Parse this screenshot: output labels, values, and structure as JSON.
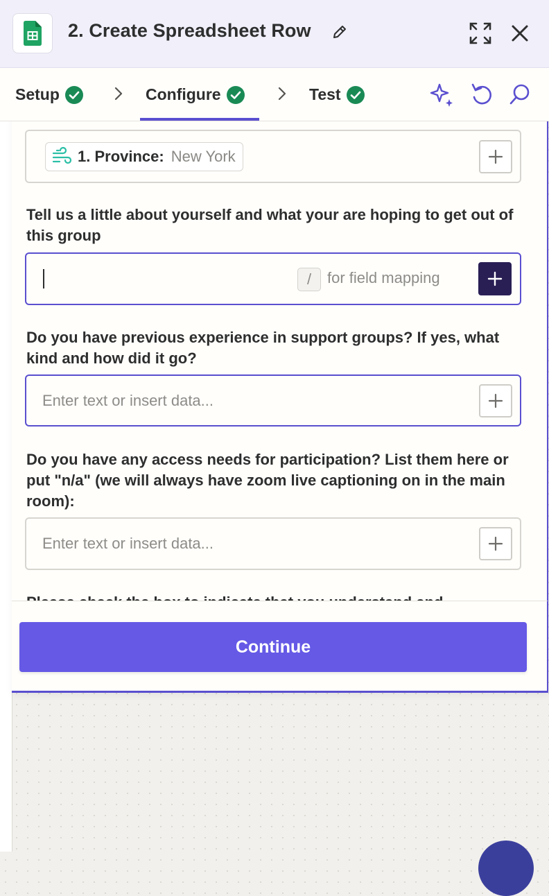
{
  "header": {
    "title": "2. Create Spreadsheet Row"
  },
  "tabs": [
    {
      "label": "Setup",
      "status": "complete"
    },
    {
      "label": "Configure",
      "status": "complete",
      "active": true
    },
    {
      "label": "Test",
      "status": "complete"
    }
  ],
  "fields": {
    "province_chip": {
      "key": "1. Province:",
      "value": "New York"
    },
    "about_yourself": {
      "label": "Tell us a little about yourself and what your are hoping to get out of this group",
      "slash_key": "/",
      "hint": "for field mapping",
      "value": ""
    },
    "experience": {
      "label": "Do you have previous experience in support groups? If yes, what kind and how did it go?",
      "placeholder": "Enter text or insert data..."
    },
    "access_needs": {
      "label": "Do you have any access needs for participation? List them here or put \"n/a\" (we will always have zoom live captioning on in the main room):",
      "placeholder": "Enter text or insert data..."
    },
    "checkbox_partial": {
      "label": "Please check the box to indicate that you understand and"
    }
  },
  "footer": {
    "continue_label": "Continue"
  },
  "colors": {
    "accent": "#5a4fcf",
    "button": "#6559e6",
    "success": "#1a8a55",
    "sheets_green": "#1fa463"
  },
  "icons": {
    "app": "google-sheets-icon",
    "edit": "pencil-icon",
    "expand": "expand-icon",
    "close": "close-icon",
    "check": "check-circle-icon",
    "chevron": "chevron-right-icon",
    "ai": "sparkle-icon",
    "reset": "rotate-left-icon",
    "search": "search-icon",
    "field_source": "wind-icon",
    "add": "plus-icon"
  }
}
